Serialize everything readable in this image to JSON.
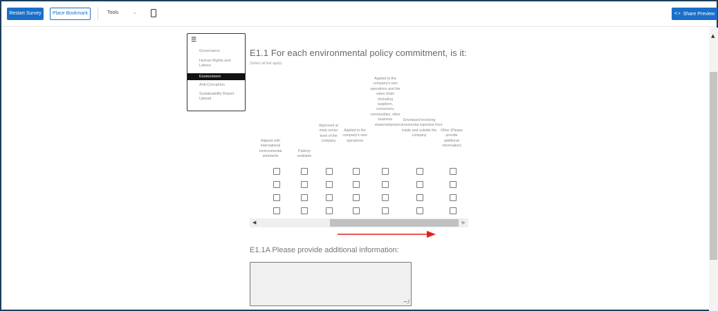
{
  "toolbar": {
    "restart_label": "Restart Survey",
    "bookmark_label": "Place Bookmark",
    "tools_label": "Tools",
    "tools_chevron": "⌄",
    "share_icon": "share-icon",
    "share_label": "Share Preview",
    "accent": "#1a6fc9"
  },
  "menu": {
    "icon": "hamburger-icon",
    "items": [
      {
        "label": "Governance",
        "active": false
      },
      {
        "label": "Human Rights and Labour",
        "active": false
      },
      {
        "label": "Environment",
        "active": true
      },
      {
        "label": "Anti-Corruption",
        "active": false
      },
      {
        "label": "Sustainability Report Upload",
        "active": false
      }
    ]
  },
  "question": {
    "title": "E1.1 For each environmental policy commitment, is it:",
    "hint": "(Select all that apply)",
    "columns": [
      "Aligned with international environmental standards",
      "Publicly available",
      "Approved at most senior level of the company",
      "Applied to the company's own operations",
      "Applied to the company's own operations and the value chain (including suppliers, consumers, communities, other business relationships)",
      "Developed involving environmental expertise from inside and outside the company",
      "Other (Please provide additional information)"
    ],
    "rows": [
      [
        false,
        false,
        false,
        false,
        false,
        false,
        false
      ],
      [
        false,
        false,
        false,
        false,
        false,
        false,
        false
      ],
      [
        false,
        false,
        false,
        false,
        false,
        false,
        false
      ],
      [
        false,
        false,
        false,
        false,
        false,
        false,
        false
      ]
    ]
  },
  "scroll": {
    "left_arrow": "◀",
    "right_arrow": "▶",
    "up_arrow": "▲"
  },
  "question2": {
    "title": "E1.1A Please provide additional information:",
    "value": ""
  }
}
